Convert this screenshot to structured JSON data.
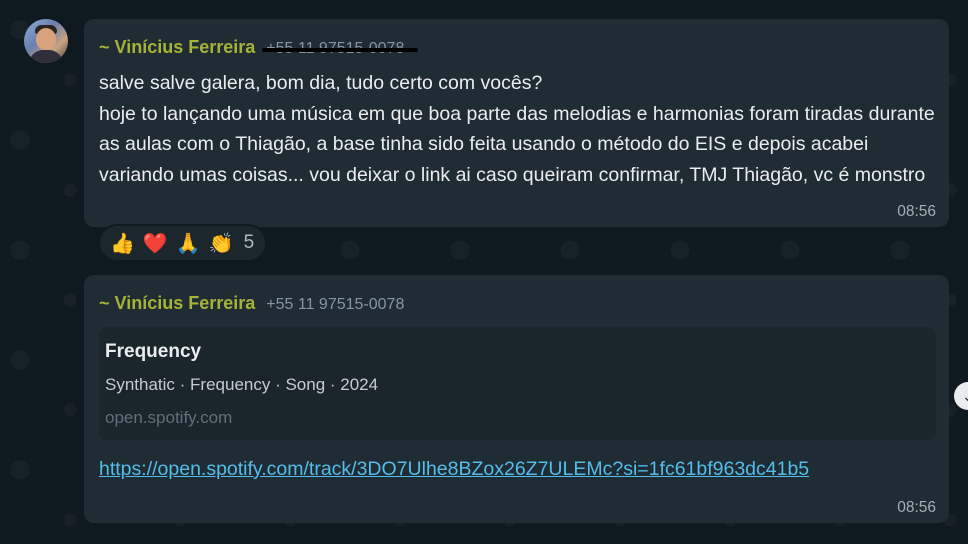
{
  "messages": [
    {
      "sender_name": "~ Vinícius Ferreira",
      "sender_phone": "+55 11 97515-0078",
      "lines": [
        "salve salve galera, bom dia, tudo certo com vocês?",
        "hoje to lançando uma música em que boa parte das melodias e harmonias foram tiradas durante as aulas com o Thiagão, a base tinha sido feita usando o método do EIS e depois acabei variando umas coisas... vou deixar o link ai caso queiram confirmar, TMJ Thiagão, vc é monstro"
      ],
      "time": "08:56",
      "reactions": {
        "emojis": [
          "👍",
          "❤️",
          "🙏",
          "👏"
        ],
        "count": "5"
      }
    },
    {
      "sender_name": "~ Vinícius Ferreira",
      "sender_phone": "+55 11 97515-0078",
      "preview": {
        "title": "Frequency",
        "description": "Synthatic · Frequency · Song · 2024",
        "domain": "open.spotify.com"
      },
      "link": "https://open.spotify.com/track/3DO7Ulhe8BZox26Z7ULEMc?si=1fc61bf963dc41b5",
      "time": "08:56"
    }
  ],
  "colors": {
    "background": "#0f1a20",
    "bubble": "#202c33",
    "sender_name": "#a5b337",
    "link": "#53bdeb",
    "meta": "#8696a0"
  },
  "icons": {
    "avatar": "user-photo",
    "scroll": "chevron-down-icon"
  }
}
